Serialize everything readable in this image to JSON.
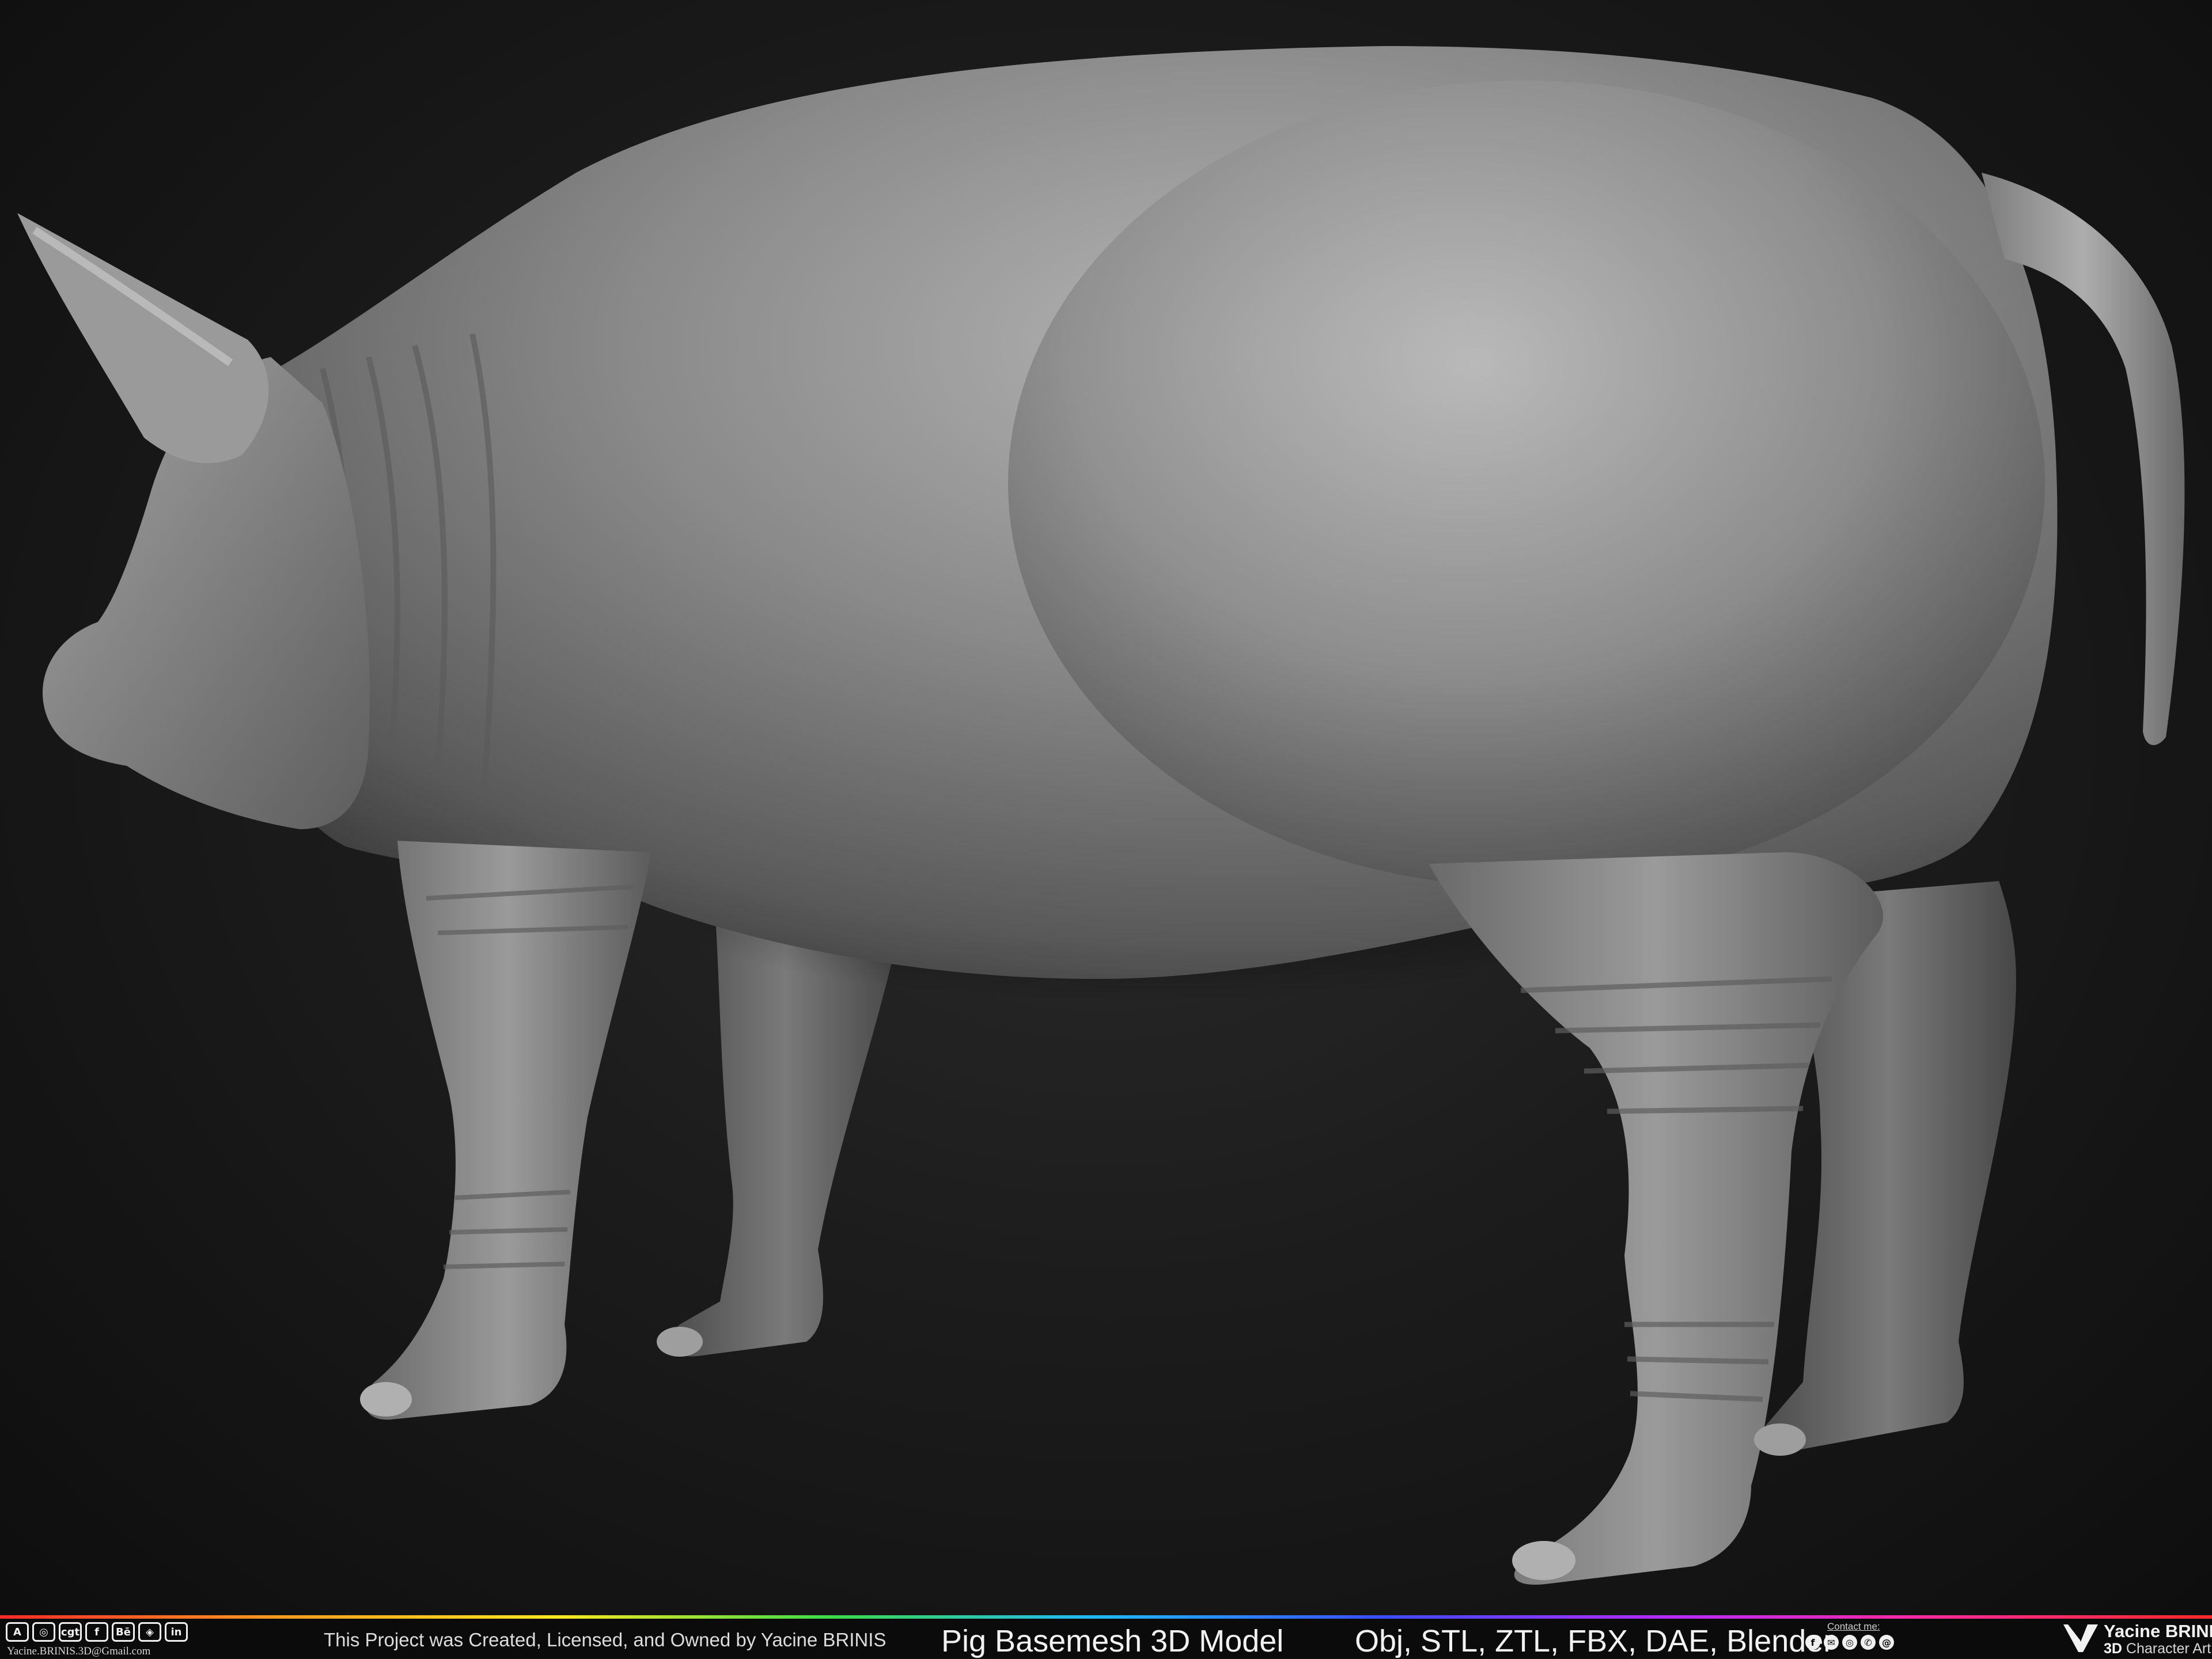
{
  "footer": {
    "social_icons": [
      {
        "name": "artstation-icon",
        "glyph": "A"
      },
      {
        "name": "instagram-icon",
        "glyph": "◎"
      },
      {
        "name": "cgtrader-icon",
        "glyph": "cgt"
      },
      {
        "name": "facebook-icon",
        "glyph": "f"
      },
      {
        "name": "behance-icon",
        "glyph": "Bē"
      },
      {
        "name": "sketchfab-icon",
        "glyph": "◈"
      },
      {
        "name": "linkedin-icon",
        "glyph": "in"
      }
    ],
    "email": "Yacine.BRINIS.3D@Gmail.com",
    "ownership": "This Project was Created, Licensed, and Owned by Yacine BRINIS",
    "title": "Pig Basemesh 3D Model",
    "formats": "Obj, STL, ZTL, FBX, DAE, Blender",
    "contact_label": "Contact me:",
    "contact_icons": [
      {
        "name": "facebook-icon",
        "glyph": "f"
      },
      {
        "name": "messenger-icon",
        "glyph": "✉"
      },
      {
        "name": "instagram-icon",
        "glyph": "◎"
      },
      {
        "name": "whatsapp-icon",
        "glyph": "✆"
      },
      {
        "name": "email-icon",
        "glyph": "@"
      }
    ],
    "brand_name": "Yacine BRINIS",
    "brand_role_prefix": "3D",
    "brand_role_rest": " Character Artist"
  },
  "colors": {
    "background": "#1a1a1a",
    "model": "#8c8c8c",
    "footer": "#0b0b0b",
    "text": "#f2f2f2"
  }
}
